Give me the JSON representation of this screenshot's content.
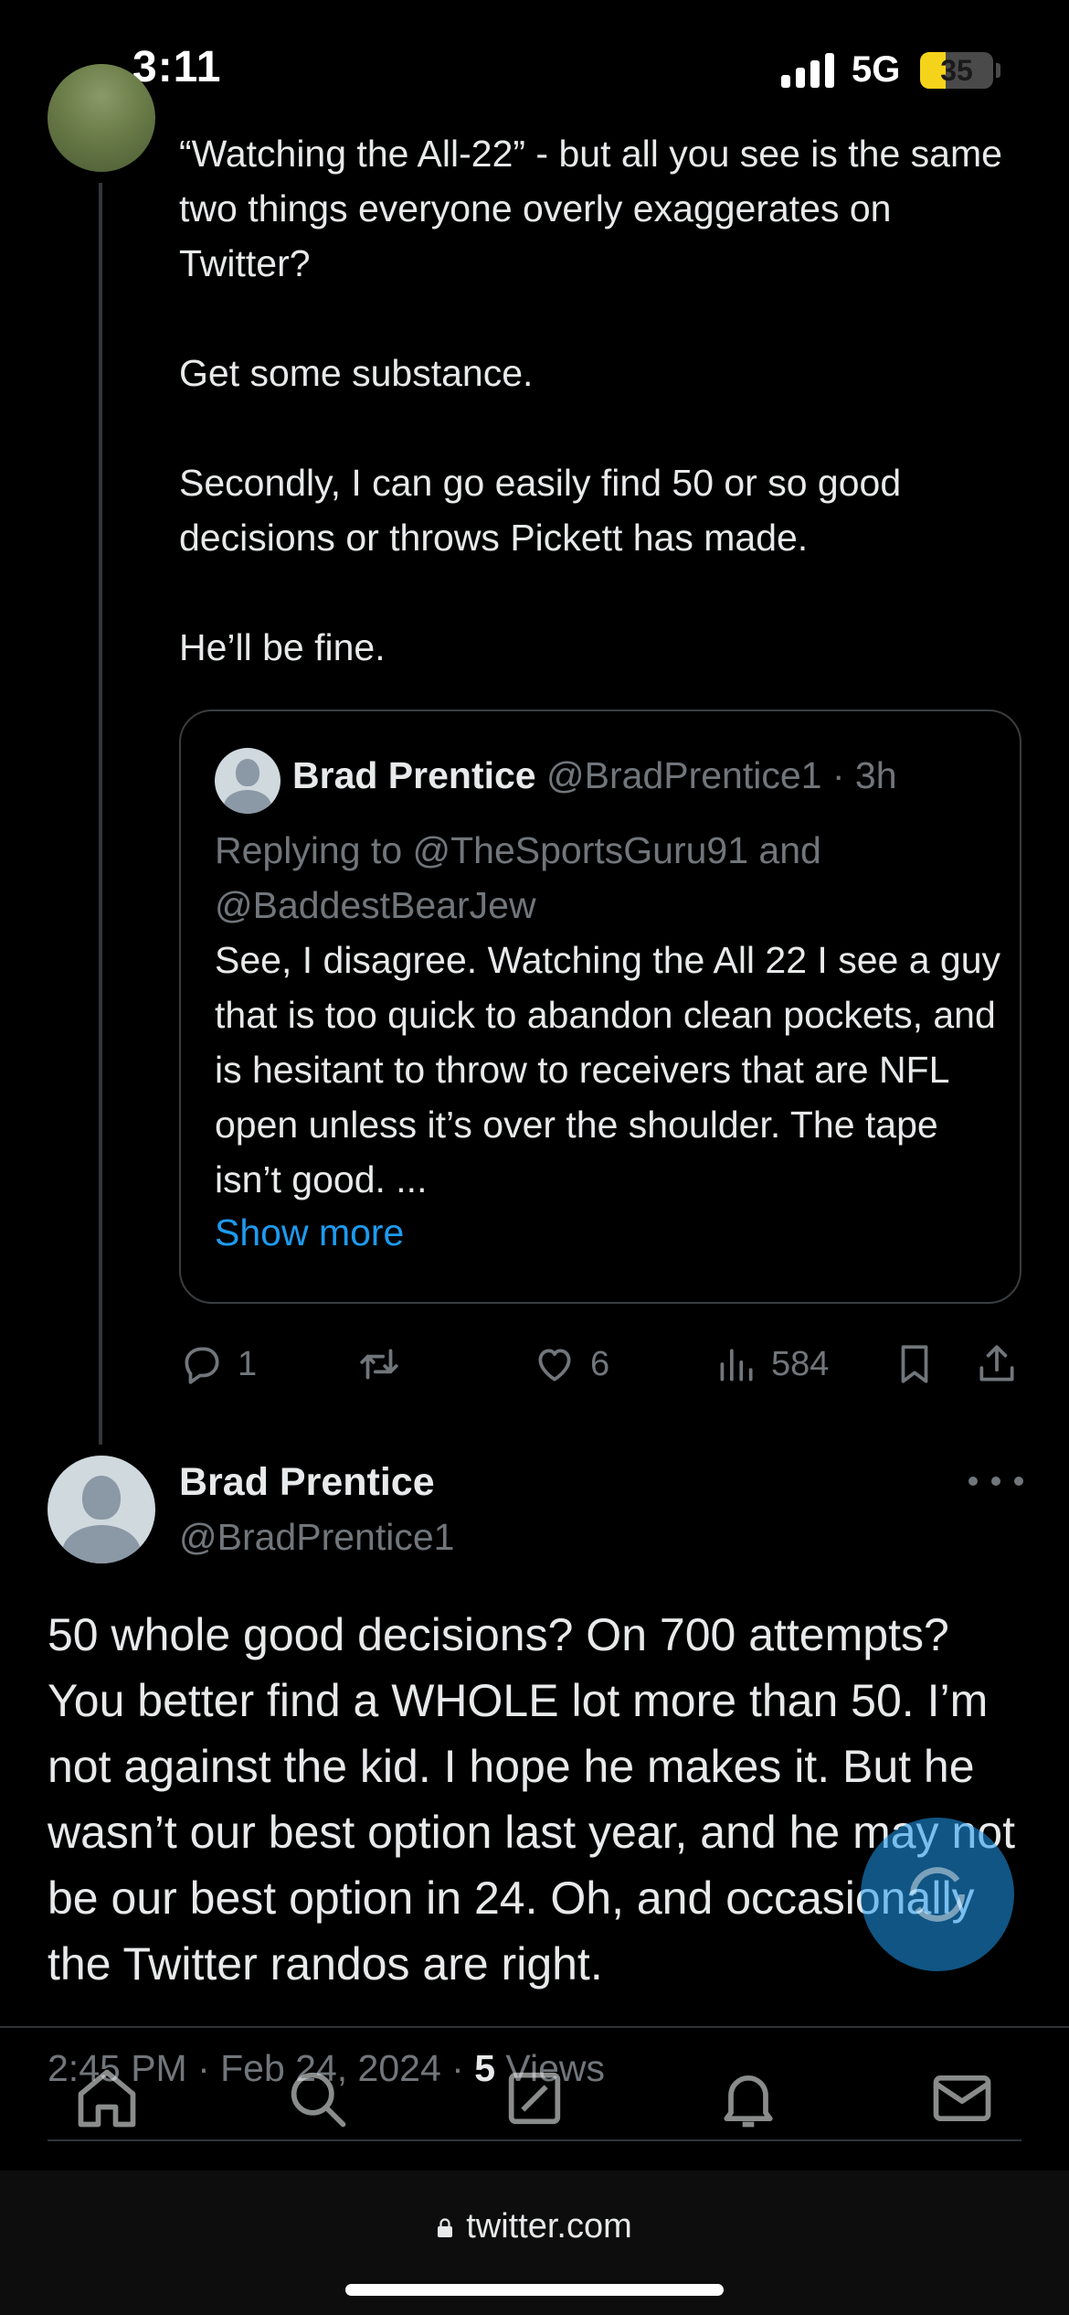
{
  "status_bar": {
    "time": "3:11",
    "network": "5G",
    "battery_level": "35",
    "battery_fraction": 0.35,
    "battery_color": "#f5d31b"
  },
  "parent_tweet": {
    "paragraphs": [
      "“Watching the All-22” - but all you see is the same two things everyone overly exaggerates on Twitter?",
      "Get some substance.",
      "Secondly, I can go easily find 50 or so good decisions or throws Pickett has made.",
      "He’ll be fine."
    ],
    "quote": {
      "name": "Brad Prentice",
      "handle_time": "@BradPrentice1 · 3h",
      "replying_to": "Replying to @TheSportsGuru91 and @BaddestBearJew",
      "body": "See, I disagree. Watching the All 22 I see a guy that is too quick to abandon clean pockets,  and is hesitant to throw to receivers that are NFL open unless it’s over the shoulder. The tape isn’t good. ...",
      "show_more": "Show more"
    },
    "actions": {
      "replies": "1",
      "retweets": "",
      "likes": "6",
      "views": "584"
    }
  },
  "main_tweet": {
    "name": "Brad Prentice",
    "handle": "@BradPrentice1",
    "body": "50 whole good decisions? On 700 attempts? You better find a WHOLE lot more than 50. I’m not  against the kid. I hope he makes it. But he wasn’t our best option last year, and he may not be our best option in 24. Oh, and occasionally the Twitter randos are right.",
    "timestamp": "2:45 PM · Feb 24, 2024 · ",
    "views_count": "5",
    "views_label": " Views"
  },
  "icons": {
    "reply": "reply-icon",
    "retweet": "retweet-icon",
    "like": "heart-icon",
    "views": "analytics-icon",
    "bookmark": "bookmark-icon",
    "share": "share-icon",
    "more": "more-icon",
    "compose": "compose-icon",
    "home": "home-icon",
    "search": "search-icon",
    "grok": "grok-icon",
    "notifications": "bell-icon",
    "messages": "mail-icon",
    "lock": "lock-icon"
  },
  "browser": {
    "url": "twitter.com"
  },
  "colors": {
    "background": "#000000",
    "text": "#e7e9ea",
    "muted": "#71767b",
    "link": "#1d9bf0",
    "border": "#2f3336"
  }
}
